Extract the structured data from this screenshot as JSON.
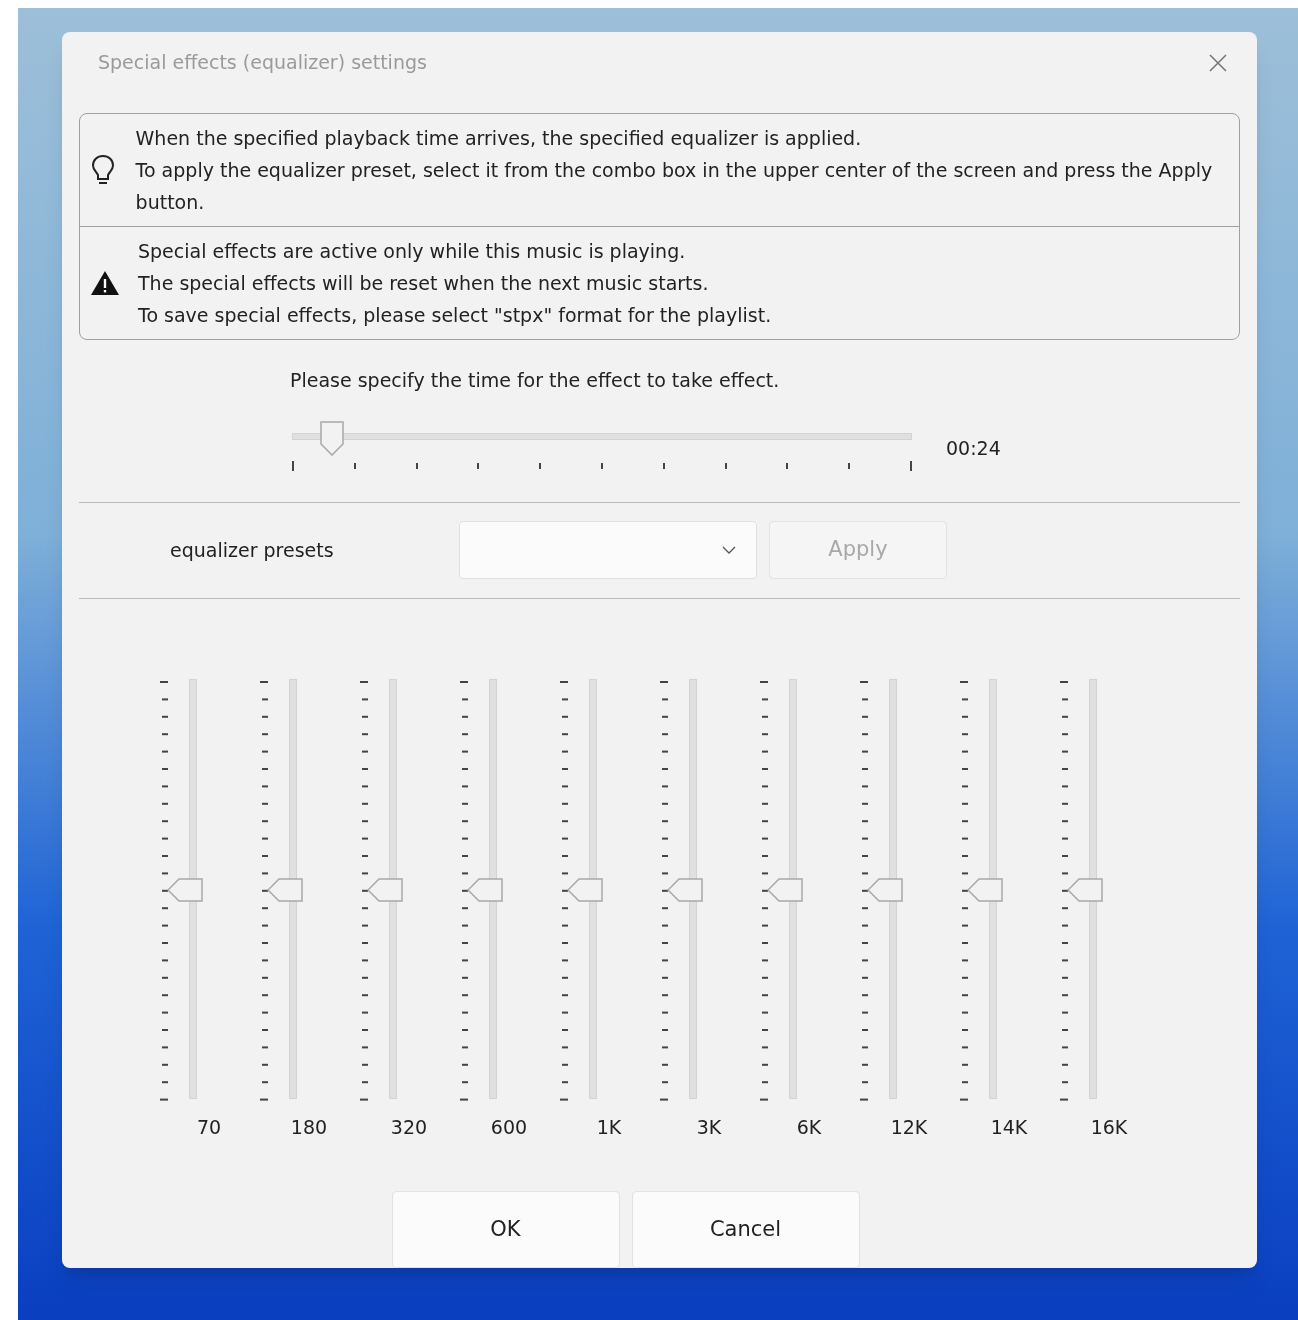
{
  "window": {
    "title": "Special effects (equalizer) settings"
  },
  "notices": [
    {
      "kind": "tip",
      "lines": [
        "When the specified playback time arrives, the specified equalizer is applied.",
        "To apply the equalizer preset, select it from the combo box in the upper center of the screen and press the Apply button."
      ]
    },
    {
      "kind": "warning",
      "lines": [
        "Special effects are active only while this music is playing.",
        "The special effects will be reset when the next music starts.",
        "To save special effects, please select \"stpx\" format for the playlist."
      ]
    }
  ],
  "time": {
    "prompt": "Please specify the time for the effect to take effect.",
    "level": 0.063,
    "reading": "00:24"
  },
  "presets": {
    "label": "equalizer presets",
    "apply_button": {
      "label": "Apply",
      "disabled": true
    }
  },
  "bands": [
    {
      "label": "70",
      "level": 0.5
    },
    {
      "label": "180",
      "level": 0.5
    },
    {
      "label": "320",
      "level": 0.5
    },
    {
      "label": "600",
      "level": 0.5
    },
    {
      "label": "1K",
      "level": 0.5
    },
    {
      "label": "3K",
      "level": 0.5
    },
    {
      "label": "6K",
      "level": 0.5
    },
    {
      "label": "12K",
      "level": 0.5
    },
    {
      "label": "14K",
      "level": 0.5
    },
    {
      "label": "16K",
      "level": 0.5
    }
  ],
  "buttons": [
    "OK",
    "Cancel"
  ]
}
